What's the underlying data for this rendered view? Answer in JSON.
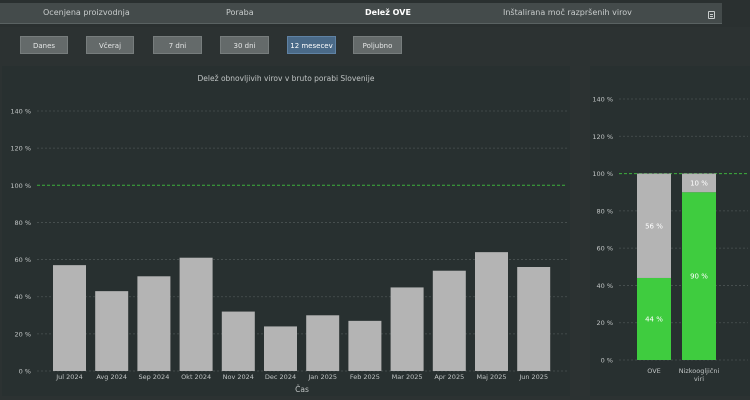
{
  "nav": {
    "tabs": [
      {
        "label": "Ocenjena proizvodnja"
      },
      {
        "label": "Poraba"
      },
      {
        "label": "Delež OVE"
      },
      {
        "label": "Inštalirana moč razpršenih virov"
      }
    ],
    "active_tab": "Delež OVE",
    "icon": "document-icon"
  },
  "range_buttons": [
    {
      "label": "Danes"
    },
    {
      "label": "Včeraj"
    },
    {
      "label": "7 dni"
    },
    {
      "label": "30 dni"
    },
    {
      "label": "12 mesecev"
    },
    {
      "label": "Poljubno"
    }
  ],
  "active_range": "12 mesecev",
  "colors": {
    "bar": "#b4b4b4",
    "green": "#3fcc3f",
    "grid": "#4a5252",
    "reference_line": "#3cb03c",
    "active_button": "#4a6a88"
  },
  "chart_data": [
    {
      "type": "bar",
      "title": "Delež obnovljivih virov v bruto porabi Slovenije",
      "xlabel": "Čas",
      "ylabel": "",
      "categories": [
        "Jul 2024",
        "Avg 2024",
        "Sep 2024",
        "Okt 2024",
        "Nov 2024",
        "Dec 2024",
        "Jan 2025",
        "Feb 2025",
        "Mar 2025",
        "Apr 2025",
        "Maj 2025",
        "Jun 2025"
      ],
      "values": [
        57,
        43,
        51,
        61,
        32,
        24,
        30,
        27,
        45,
        54,
        64,
        56
      ],
      "ylim": [
        0,
        140
      ],
      "yticks": [
        "0 %",
        "20 %",
        "40 %",
        "60 %",
        "80 %",
        "100 %",
        "120 %",
        "140 %"
      ],
      "reference_line": 100,
      "grid": true,
      "legend": "none"
    },
    {
      "type": "bar",
      "stacked": true,
      "categories": [
        "OVE",
        "Nizkoogljični viri"
      ],
      "series": [
        {
          "values": [
            44,
            90
          ],
          "labels": [
            "44 %",
            "90 %"
          ],
          "color": "#3fcc3f"
        },
        {
          "values": [
            56,
            10
          ],
          "labels": [
            "56 %",
            "10 %"
          ],
          "color": "#b4b4b4"
        }
      ],
      "ylim": [
        0,
        140
      ],
      "yticks": [
        "0 %",
        "20 %",
        "40 %",
        "60 %",
        "80 %",
        "100 %",
        "120 %",
        "140 %"
      ],
      "reference_line": 100,
      "grid": true,
      "legend": "none"
    }
  ]
}
